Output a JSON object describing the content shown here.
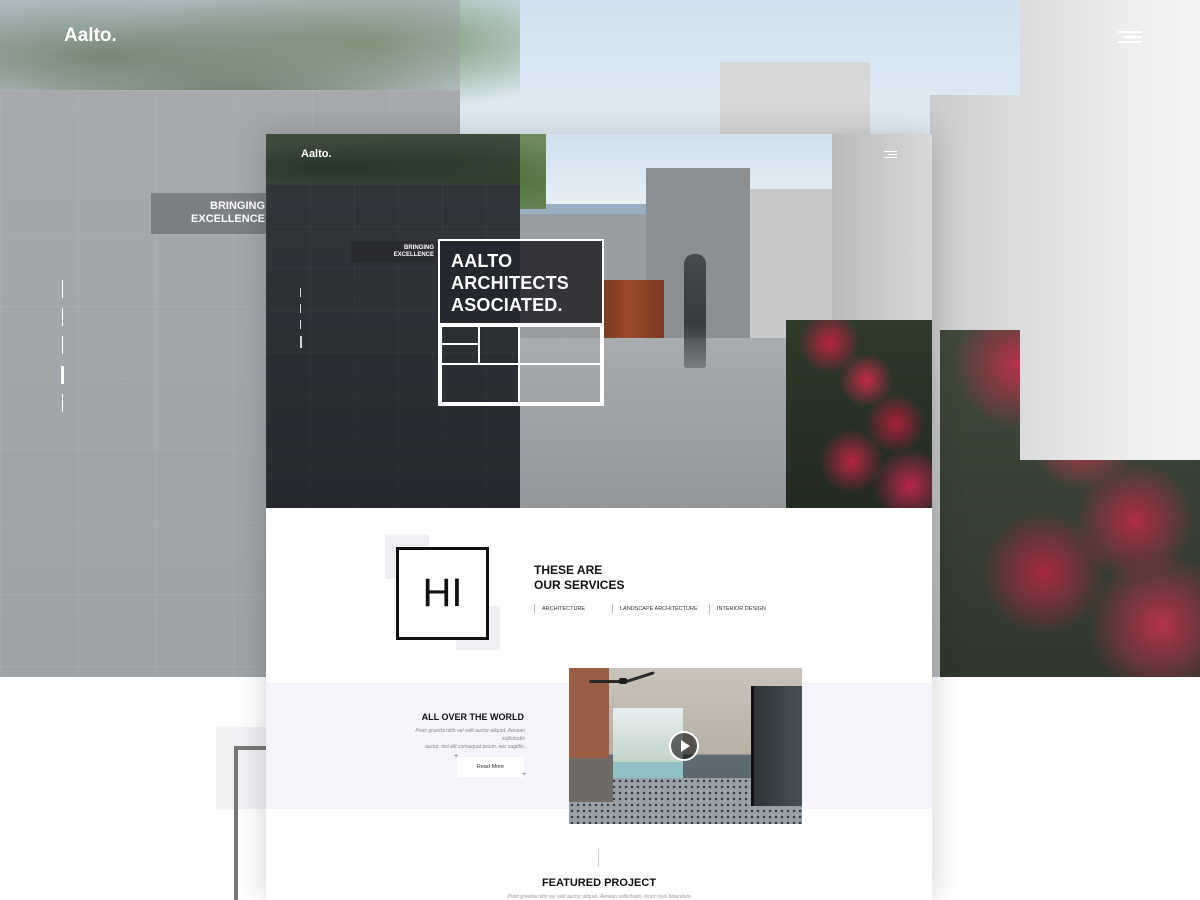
{
  "background": {
    "logo": "Aalto.",
    "tagline_line1": "BRINGING",
    "tagline_line2": "EXCELLENCE"
  },
  "card": {
    "header": {
      "logo": "Aalto."
    },
    "hero": {
      "tagline_line1": "BRINGING",
      "tagline_line2": "EXCELLENCE",
      "title_line1": "AALTO",
      "title_line2": "ARCHITECTS",
      "title_line3": "ASOCIATED.",
      "slide_indicator": {
        "total": 4,
        "active": 4
      }
    },
    "services": {
      "badge": "HI",
      "title_line1": "THESE ARE",
      "title_line2": "OUR SERVICES",
      "items": [
        "ARCHITECTURE",
        "LANDSCAPE ARCHITECTURE",
        "INTERIOR DESIGN"
      ]
    },
    "world": {
      "title": "ALL OVER THE WORLD",
      "text_line1": "Proin gravida nibh vel velit auctor aliquet. Aenean sollicitudin",
      "text_line2": "auctor, nisi elit consequat ipsum, nec sagittis.",
      "read_more": "Read More"
    },
    "featured": {
      "title": "FEATURED PROJECT",
      "text": "Proin gravida nibh vel velit auctor aliquet. Aenean sollicitudin, lorem quis bibendum"
    }
  },
  "colors": {
    "text_dark": "#111111",
    "accent_panel": "#2a2c31",
    "band": "#f4f5fa"
  },
  "icons": [
    "hamburger-menu-icon",
    "play-icon",
    "plus-icon"
  ]
}
